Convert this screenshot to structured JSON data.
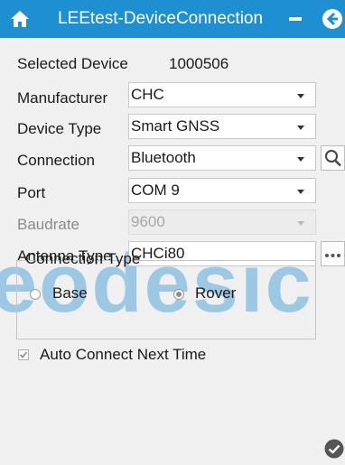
{
  "titlebar": {
    "title": "LEEtest-DeviceConnection",
    "background": "#1e90d2",
    "icons": [
      "home-icon",
      "minimize-icon",
      "back-arrow-icon"
    ]
  },
  "selected_device": {
    "label": "Selected Device",
    "value": "1000506"
  },
  "manufacturer": {
    "label": "Manufacturer",
    "value": "CHC"
  },
  "device_type": {
    "label": "Device Type",
    "value": "Smart GNSS"
  },
  "connection": {
    "label": "Connection",
    "value": "Bluetooth",
    "side_icon": "search-icon"
  },
  "port": {
    "label": "Port",
    "value": "COM 9"
  },
  "baudrate": {
    "label": "Baudrate",
    "value": "9600",
    "disabled": true
  },
  "antenna_type": {
    "label": "Antenna Type",
    "value": "CHCi80",
    "side_icon": "more-icon"
  },
  "connection_type": {
    "label": "Connection Type",
    "options": [
      {
        "label": "Base",
        "selected": false
      },
      {
        "label": "Rover",
        "selected": true
      }
    ]
  },
  "auto_connect": {
    "label": "Auto Connect Next Time",
    "checked": true
  },
  "watermark": "eodesic",
  "footer": {
    "icons": [
      "confirm-check-icon"
    ]
  }
}
